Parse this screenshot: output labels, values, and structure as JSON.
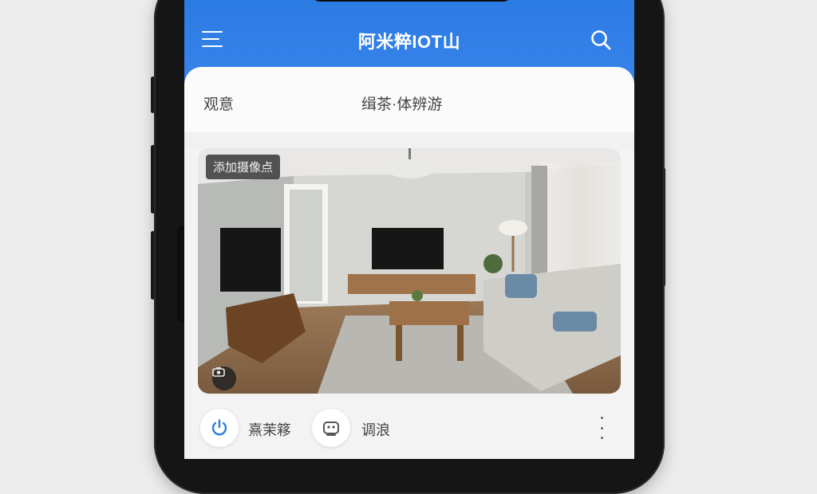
{
  "app": {
    "title": "阿米粹IOT山"
  },
  "header": {
    "menu_icon": "hamburger-menu-icon",
    "search_icon": "search-icon"
  },
  "tabs": [
    {
      "label": "观意"
    },
    {
      "label": "缉茶·体辨游"
    }
  ],
  "camera": {
    "add_camera_label": "添加摄像点",
    "badge_icon": "camera-switch-icon"
  },
  "actions": [
    {
      "icon": "power-icon",
      "label": "熹茉簃"
    },
    {
      "icon": "robot-vacuum-icon",
      "label": "调浪"
    }
  ],
  "more_icon": "more-vertical-icon",
  "colors": {
    "accent": "#2c7be3",
    "screen_bg": "#f3f3f3",
    "phone_frame": "#151515"
  }
}
